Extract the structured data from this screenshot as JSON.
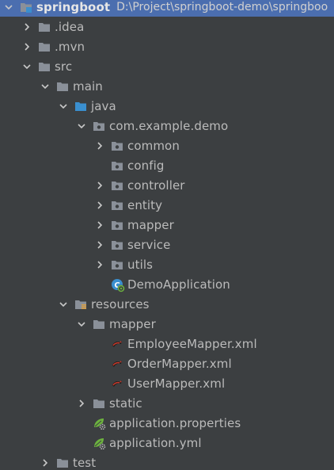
{
  "project": {
    "name": "springboot",
    "path": "D:\\Project\\springboot-demo\\springboo"
  },
  "nodes": {
    "idea": ".idea",
    "mvn": ".mvn",
    "src": "src",
    "main": "main",
    "java": "java",
    "package": "com.example.demo",
    "common": "common",
    "config": "config",
    "controller": "controller",
    "entity": "entity",
    "mapper": "mapper",
    "service": "service",
    "utils": "utils",
    "demo_application": "DemoApplication",
    "resources": "resources",
    "res_mapper": "mapper",
    "employee_mapper": "EmployeeMapper.xml",
    "order_mapper": "OrderMapper.xml",
    "user_mapper": "UserMapper.xml",
    "static": "static",
    "app_properties": "application.properties",
    "app_yml": "application.yml",
    "test": "test"
  },
  "colors": {
    "background": "#3c3f41",
    "selection": "#4b6eaf",
    "text": "#bbbbbb",
    "folder": "#8a9099",
    "source_folder": "#3a8fcf",
    "spring_green": "#6db33f",
    "mybatis_red": "#c0392b"
  }
}
